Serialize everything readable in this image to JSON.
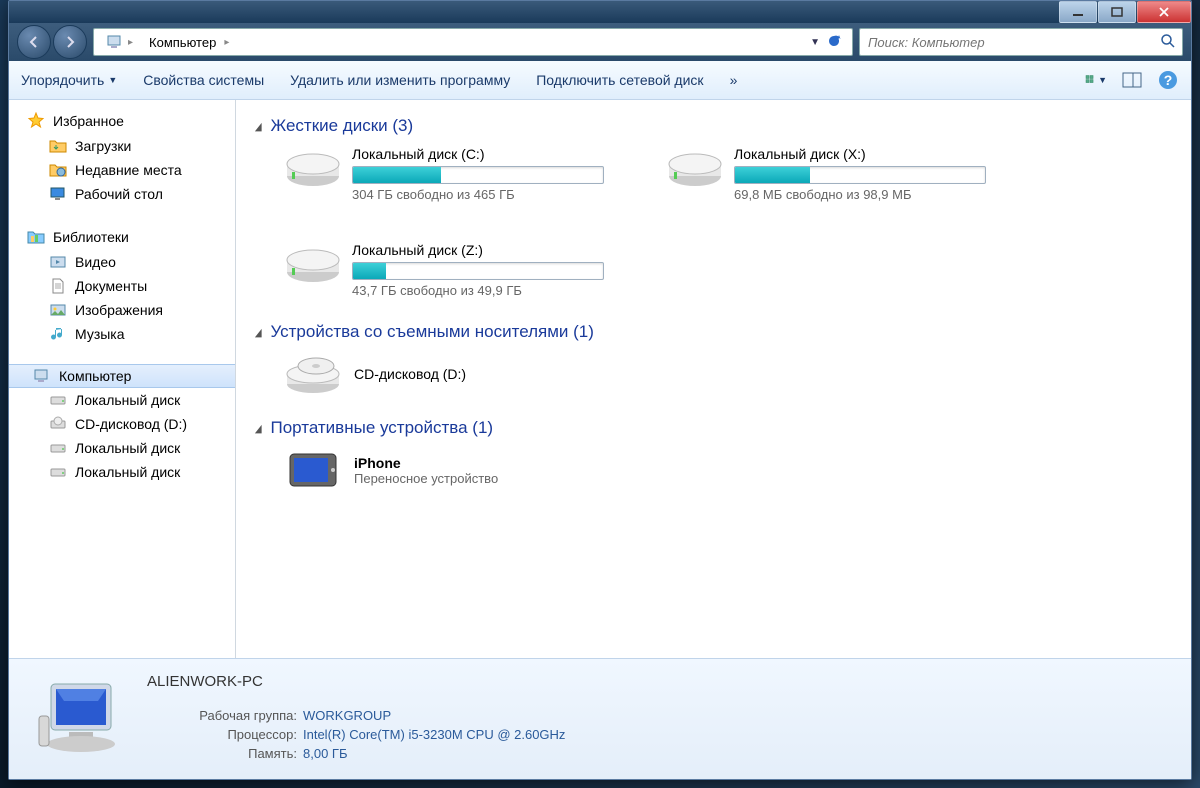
{
  "breadcrumb": {
    "root": "Компьютер"
  },
  "search": {
    "placeholder": "Поиск: Компьютер"
  },
  "toolbar": {
    "organize": "Упорядочить",
    "system_props": "Свойства системы",
    "uninstall": "Удалить или изменить программу",
    "map_drive": "Подключить сетевой диск"
  },
  "sidebar": {
    "favorites": {
      "label": "Избранное",
      "items": [
        "Загрузки",
        "Недавние места",
        "Рабочий стол"
      ]
    },
    "libraries": {
      "label": "Библиотеки",
      "items": [
        "Видео",
        "Документы",
        "Изображения",
        "Музыка"
      ]
    },
    "computer": {
      "label": "Компьютер",
      "items": [
        "Локальный диск",
        "CD-дисковод (D:)",
        "Локальный диск",
        "Локальный диск"
      ]
    }
  },
  "sections": {
    "hdd": "Жесткие диски (3)",
    "removable": "Устройства со съемными носителями (1)",
    "portable": "Портативные устройства (1)"
  },
  "drives": [
    {
      "name": "Локальный диск (C:)",
      "free": "304 ГБ свободно из 465 ГБ",
      "fill": 35
    },
    {
      "name": "Локальный диск (X:)",
      "free": "69,8 МБ свободно из 98,9 МБ",
      "fill": 30
    },
    {
      "name": "Локальный диск (Z:)",
      "free": "43,7 ГБ свободно из 49,9 ГБ",
      "fill": 13
    }
  ],
  "optical": {
    "name": "CD-дисковод (D:)"
  },
  "portable": {
    "name": "iPhone",
    "type": "Переносное устройство"
  },
  "details": {
    "computer_name": "ALIENWORK-PC",
    "workgroup_label": "Рабочая группа:",
    "workgroup": "WORKGROUP",
    "cpu_label": "Процессор:",
    "cpu": "Intel(R) Core(TM) i5-3230M CPU @ 2.60GHz",
    "ram_label": "Память:",
    "ram": "8,00 ГБ"
  }
}
